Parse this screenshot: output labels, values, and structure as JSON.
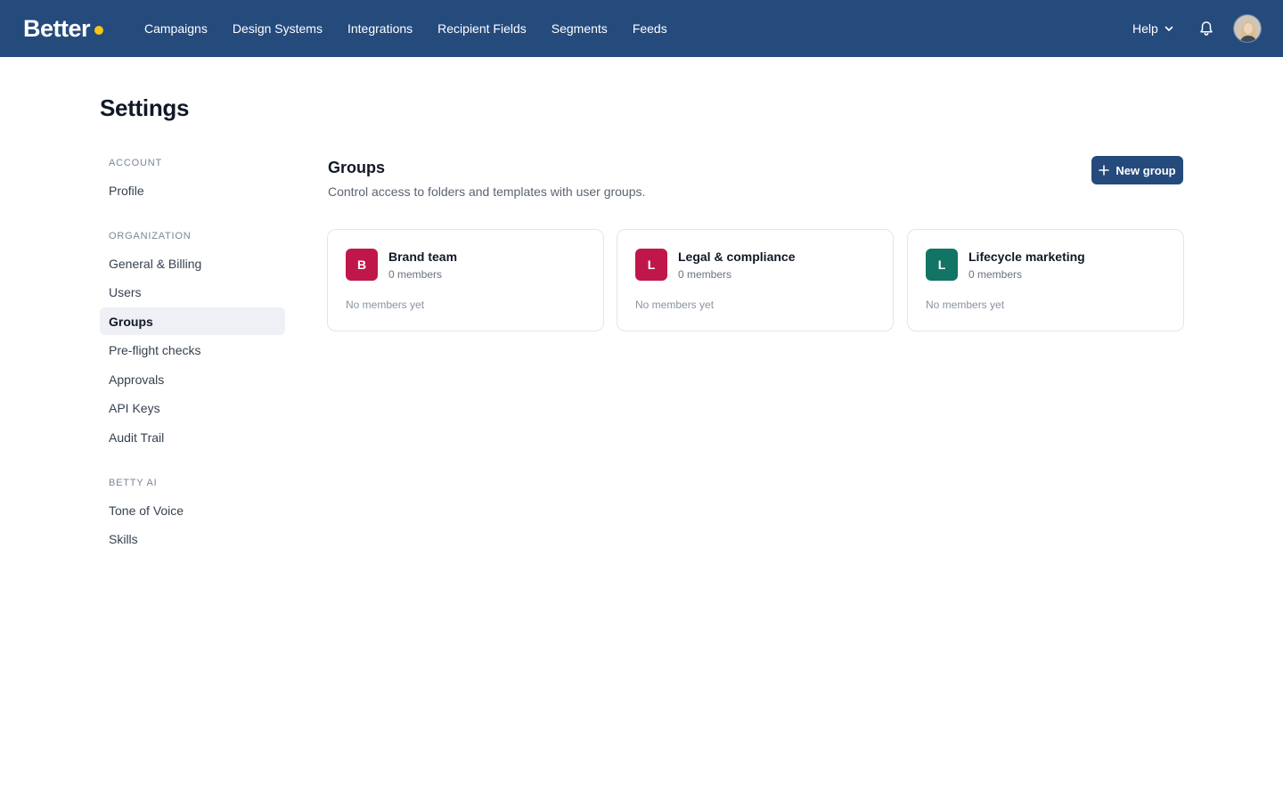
{
  "brand": {
    "logo_text": "Better",
    "accent_dot_color": "#f5c518",
    "nav_color": "#254a7c"
  },
  "nav": {
    "links": [
      "Campaigns",
      "Design Systems",
      "Integrations",
      "Recipient Fields",
      "Segments",
      "Feeds"
    ],
    "help_label": "Help"
  },
  "page": {
    "title": "Settings"
  },
  "sidebar": {
    "sections": [
      {
        "label": "ACCOUNT",
        "items": [
          "Profile"
        ]
      },
      {
        "label": "ORGANIZATION",
        "items": [
          "General & Billing",
          "Users",
          "Groups",
          "Pre-flight checks",
          "Approvals",
          "API Keys",
          "Audit Trail"
        ]
      },
      {
        "label": "BETTY AI",
        "items": [
          "Tone of Voice",
          "Skills"
        ]
      }
    ],
    "active_item": "Groups"
  },
  "main": {
    "title": "Groups",
    "subtitle": "Control access to folders and templates with user groups.",
    "new_button_label": "New group",
    "groups": [
      {
        "initial": "B",
        "name": "Brand team",
        "members": "0 members",
        "empty_text": "No members yet",
        "color": "#c0174a"
      },
      {
        "initial": "L",
        "name": "Legal & compliance",
        "members": "0 members",
        "empty_text": "No members yet",
        "color": "#c0174a"
      },
      {
        "initial": "L",
        "name": "Lifecycle marketing",
        "members": "0 members",
        "empty_text": "No members yet",
        "color": "#117465"
      }
    ]
  }
}
